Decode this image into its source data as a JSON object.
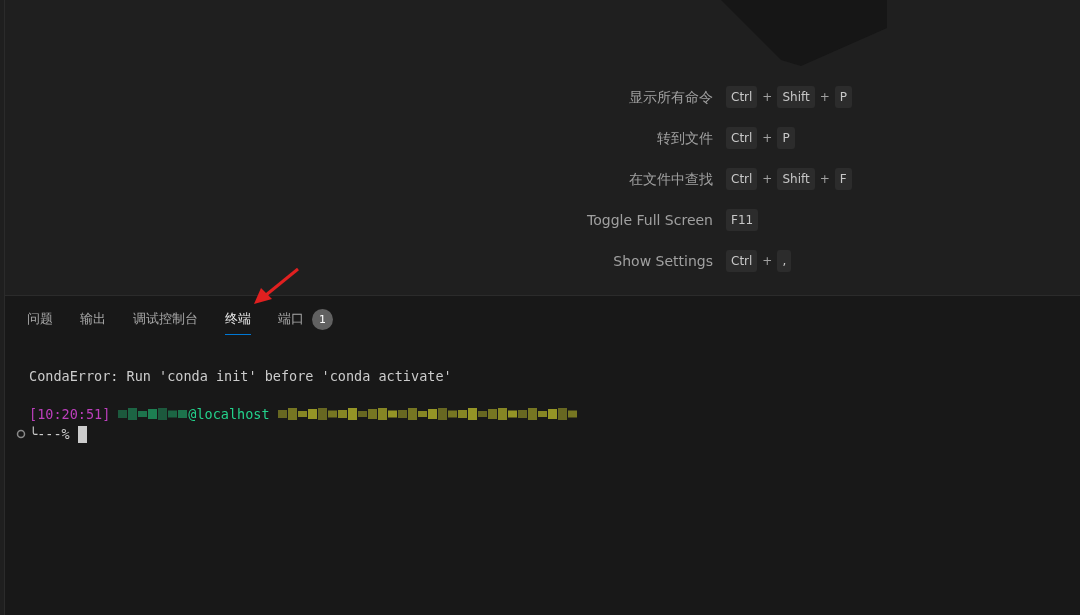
{
  "shortcuts": [
    {
      "label": "显示所有命令",
      "keys": [
        "Ctrl",
        "Shift",
        "P"
      ],
      "separator": "+"
    },
    {
      "label": "转到文件",
      "keys": [
        "Ctrl",
        "P"
      ],
      "separator": "+"
    },
    {
      "label": "在文件中查找",
      "keys": [
        "Ctrl",
        "Shift",
        "F"
      ],
      "separator": "+"
    },
    {
      "label": "Toggle Full Screen",
      "keys": [
        "F11"
      ]
    },
    {
      "label": "Show Settings",
      "keys": [
        "Ctrl",
        ","
      ],
      "separator": "+"
    }
  ],
  "panel_tabs": [
    {
      "label": "问题",
      "selected": false
    },
    {
      "label": "输出",
      "selected": false
    },
    {
      "label": "调试控制台",
      "selected": false
    },
    {
      "label": "终端",
      "selected": true
    },
    {
      "label": "端口",
      "selected": false,
      "badge": "1"
    }
  ],
  "terminal": {
    "error": "CondaError: Run 'conda init' before 'conda activate'",
    "time": "[10:20:51]",
    "host": "@localhost",
    "prompt": "╰---%"
  }
}
